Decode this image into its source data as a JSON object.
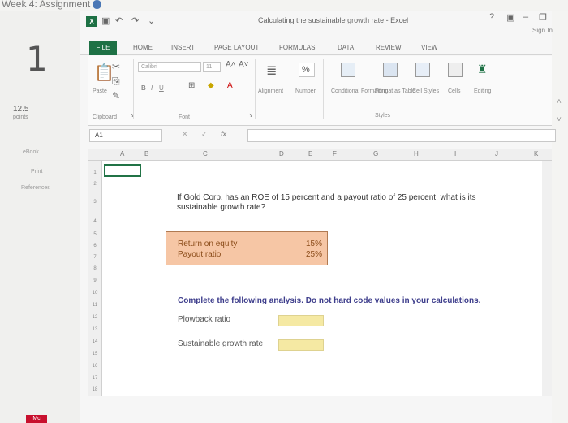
{
  "lms": {
    "assignment_title": "Week 4: Assignment",
    "info_glyph": "i",
    "question_number": "1",
    "points_value": "12.5",
    "points_label": "points",
    "links": [
      "eBook",
      "Print",
      "References"
    ],
    "logo": "Mc"
  },
  "excel": {
    "window_title": "Calculating the sustainable growth rate - Excel",
    "help_glyph": "?",
    "sign_in": "Sign In",
    "tabs": [
      "FILE",
      "HOME",
      "INSERT",
      "PAGE LAYOUT",
      "FORMULAS",
      "DATA",
      "REVIEW",
      "VIEW"
    ],
    "ribbon": {
      "paste": "Paste",
      "clipboard": "Clipboard",
      "font_name": "Calibri",
      "font_size": "11",
      "bold": "B",
      "italic": "I",
      "underline": "U",
      "font_group": "Font",
      "alignment": "Alignment",
      "number": "Number",
      "percent_glyph": "%",
      "conditional_formatting": "Conditional Formatting",
      "format_as_table": "Format as Table",
      "cell_styles": "Cell Styles",
      "styles_group": "Styles",
      "cells": "Cells",
      "editing": "Editing"
    },
    "name_box": "A1",
    "fx_label": "fx",
    "columns": [
      "A",
      "B",
      "C",
      "D",
      "E",
      "F",
      "G",
      "H",
      "I",
      "J",
      "K"
    ],
    "rows": [
      "1",
      "2",
      "3",
      "4",
      "5",
      "6",
      "7",
      "8",
      "9",
      "10",
      "11",
      "12",
      "13",
      "14",
      "15",
      "16",
      "17",
      "18"
    ],
    "question_text": "If Gold Corp. has an ROE of 15 percent and a payout ratio of 25 percent, what is its sustainable growth rate?",
    "inputs": [
      {
        "label": "Return on equity",
        "value": "15%"
      },
      {
        "label": "Payout ratio",
        "value": "25%"
      }
    ],
    "instruction": "Complete the following analysis. Do not hard code values in your calculations.",
    "analysis": [
      {
        "label": "Plowback ratio",
        "value": ""
      },
      {
        "label": "Sustainable growth rate",
        "value": ""
      }
    ]
  }
}
